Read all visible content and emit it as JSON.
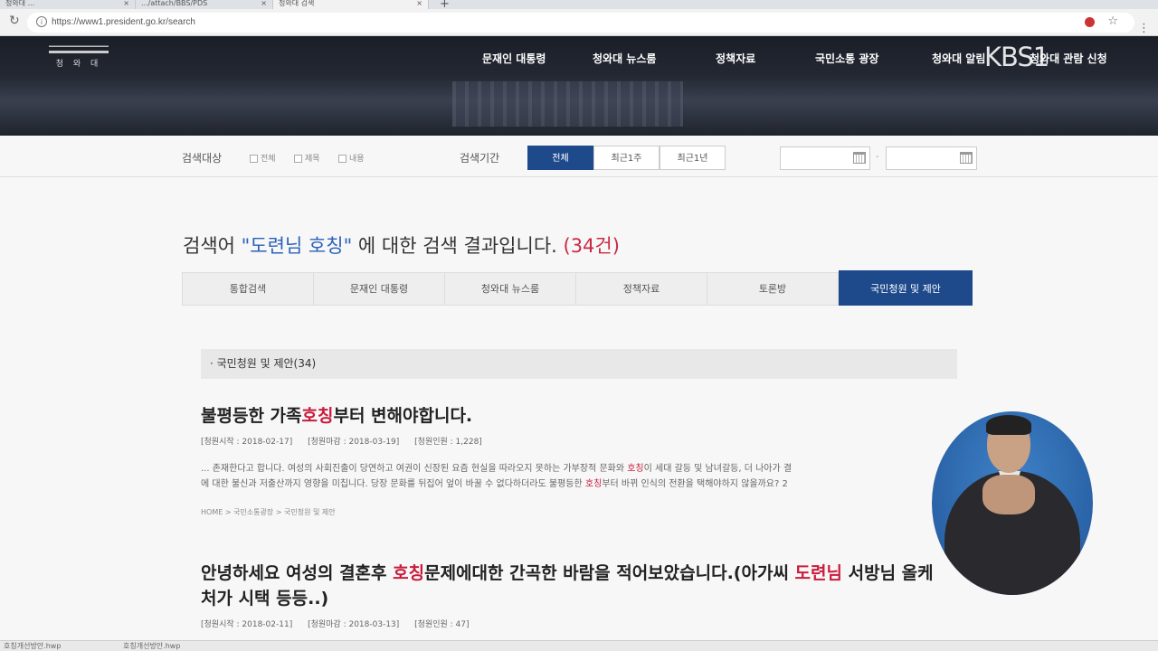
{
  "browser": {
    "tabs": [
      {
        "label": "청와대 ..."
      },
      {
        "label": ".../attach/BBS/PDS"
      },
      {
        "label": "청와대 검색"
      }
    ],
    "url": "https://www1.president.go.kr/search"
  },
  "site": {
    "logo_text": "청 와 대",
    "nav": [
      "문재인 대통령",
      "청와대 뉴스룸",
      "정책자료",
      "국민소통 광장",
      "청와대 알림",
      "청와대 관람 신청"
    ],
    "broadcaster": "KBS1"
  },
  "filter": {
    "target_label": "검색대상",
    "targets": [
      "전체",
      "제목",
      "내용"
    ],
    "period_label": "검색기간",
    "periods": [
      "전체",
      "최근1주",
      "최근1년"
    ],
    "active_period": "전체",
    "date_separator": "-"
  },
  "results": {
    "prefix": "검색어 ",
    "keyword": "\"도련님 호칭\"",
    "suffix": " 에 대한 검색 결과입니다. ",
    "count": "(34건)"
  },
  "category_tabs": [
    "통합검색",
    "문재인 대통령",
    "청와대 뉴스룸",
    "정책자료",
    "토론방",
    "국민청원 및 제안"
  ],
  "active_category": "국민청원 및 제안",
  "section_title": "· 국민청원 및 제안(34)",
  "items": [
    {
      "title_pre": "불평등한 가족",
      "title_hl": "호칭",
      "title_post": "부터 변해야합니다.",
      "meta": [
        "[청원시작 : 2018-02-17]",
        "[청원마감 : 2018-03-19]",
        "[청원인원 : 1,228]"
      ],
      "snippet1_pre": "... 존재한다고 합니다. 여성의 사회진출이 당연하고 여권이 신장된 요즘 현실을 따라오지 못하는 가부장적 문화와 ",
      "snippet1_hl": "호칭",
      "snippet1_post": "이 세대 갈등 및 남녀갈등, 더 나아가 결",
      "snippet2_pre": "에 대한 불신과 저출산까지 영향을 미칩니다. 당장 문화를 뒤집어 엎이 바꿀 수 없다하더라도 불평등한 ",
      "snippet2_hl": "호칭",
      "snippet2_post": "부터 바뀌 인식의 전환을 택해야하지 않을까요? 2",
      "crumb": "HOME > 국민소통광장 > 국민청원 및 제안"
    },
    {
      "title_pre": "안녕하세요 여성의 결혼후 ",
      "title_hl": "호칭",
      "title_mid": "문제에대한 간곡한 바람을 적어보았습니다.(아가씨 ",
      "title_hl2": "도련님",
      "title_post": " 서방님 올케",
      "title_line2": "처가 시택 등등..)",
      "meta": [
        "[청원시작 : 2018-02-11]",
        "[청원마감 : 2018-03-13]",
        "[청원인원 : 47]"
      ]
    }
  ],
  "downloads": [
    "호칭개선방안.hwp",
    "호칭개선방안.hwp"
  ],
  "colors": {
    "accent": "#1e4a8c",
    "highlight": "#c91c3c",
    "keyword": "#2c62b8"
  }
}
